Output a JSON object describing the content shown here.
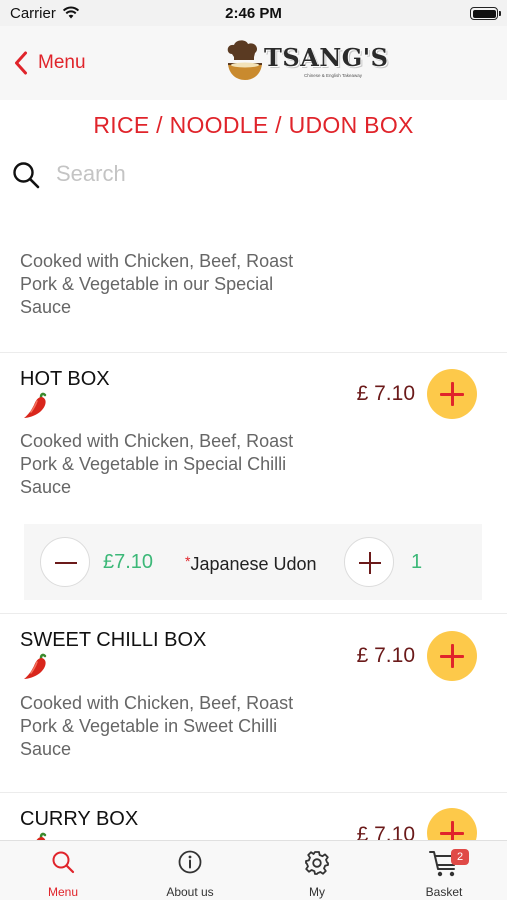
{
  "status_bar": {
    "carrier": "Carrier",
    "time": "2:46 PM"
  },
  "nav": {
    "back_label": "Menu",
    "logo_text": "TSANG'S",
    "logo_subtitle": "Chinese & English Takeaway"
  },
  "page": {
    "title": "RICE / NOODLE / UDON BOX"
  },
  "search": {
    "placeholder": "Search"
  },
  "items": [
    {
      "name": "",
      "description": "Cooked with Chicken, Beef, Roast Pork & Vegetable in our Special Sauce"
    },
    {
      "name": "HOT BOX",
      "price": "£ 7.10",
      "description": "Cooked with Chicken, Beef, Roast Pork & Vegetable in Special Chilli Sauce",
      "option": {
        "price": "£7.10",
        "required_mark": "*",
        "name": "Japanese Udon",
        "quantity": "1"
      }
    },
    {
      "name": "SWEET CHILLI BOX",
      "price": "£ 7.10",
      "description": "Cooked with Chicken, Beef, Roast Pork & Vegetable in Sweet Chilli Sauce"
    },
    {
      "name": "CURRY BOX",
      "price": "£ 7.10"
    }
  ],
  "tabs": [
    {
      "label": "Menu",
      "icon": "search-icon",
      "active": true
    },
    {
      "label": "About us",
      "icon": "info-icon"
    },
    {
      "label": "My",
      "icon": "gear-icon"
    },
    {
      "label": "Basket",
      "icon": "cart-icon",
      "badge": "2"
    }
  ],
  "colors": {
    "accent": "#e0242b",
    "add_button": "#fdc94a",
    "price": "#6b1a1a",
    "option_green": "#3cb878"
  }
}
